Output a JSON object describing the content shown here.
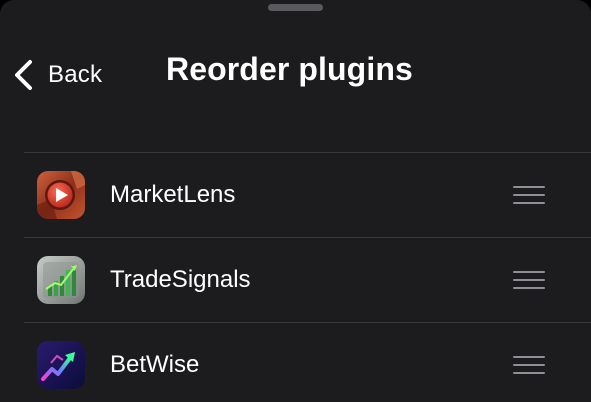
{
  "header": {
    "back_label": "Back",
    "title": "Reorder plugins"
  },
  "plugins": [
    {
      "name": "MarketLens",
      "icon": "marketlens-app-icon"
    },
    {
      "name": "TradeSignals",
      "icon": "tradesignals-app-icon"
    },
    {
      "name": "BetWise",
      "icon": "betwise-app-icon"
    }
  ],
  "colors": {
    "background": "#1c1c1e",
    "text": "#ffffff",
    "divider": "#38383a",
    "handle": "#8e8e93"
  }
}
